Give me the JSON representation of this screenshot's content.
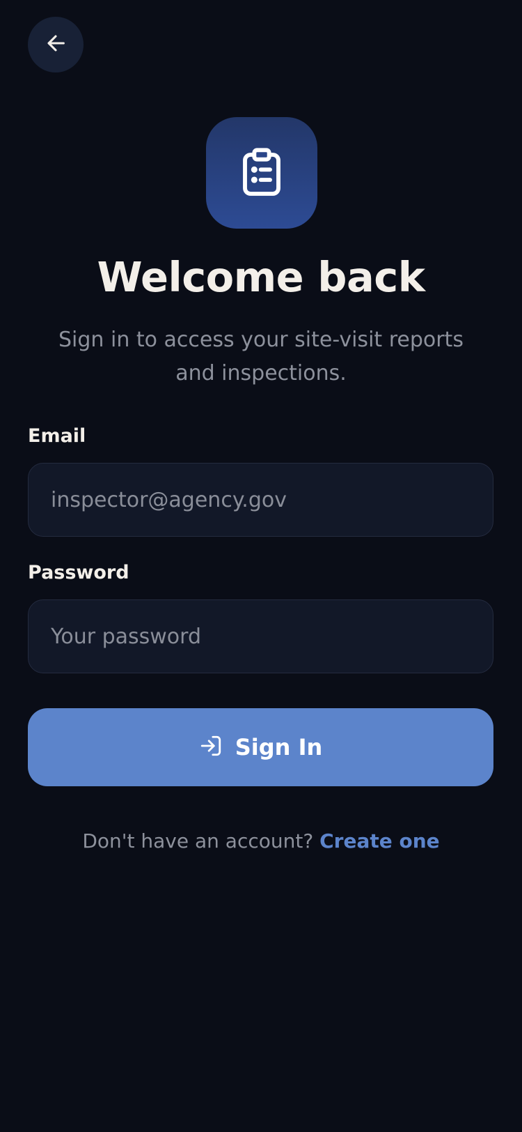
{
  "header": {
    "back_icon": "arrow-left-icon"
  },
  "brand": {
    "icon": "clipboard-list-icon",
    "title": "Welcome back",
    "subtitle": "Sign in to access your site-visit reports and inspections."
  },
  "form": {
    "email": {
      "label": "Email",
      "placeholder": "inspector@agency.gov",
      "value": ""
    },
    "password": {
      "label": "Password",
      "placeholder": "Your password",
      "value": ""
    },
    "submit": {
      "icon": "log-in-icon",
      "label": "Sign In"
    }
  },
  "footer": {
    "prompt": "Don't have an account? ",
    "link_label": "Create one"
  },
  "colors": {
    "background": "#0a0d17",
    "surface": "#121828",
    "accent": "#5c84cb",
    "icon_tile": "#2d4b94",
    "text_primary": "#f3efe9",
    "text_muted": "#8d919c"
  }
}
